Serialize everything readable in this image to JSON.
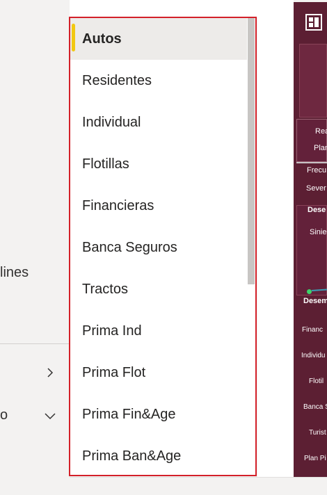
{
  "left_panel": {
    "partial_text": "lines",
    "rows": [
      {
        "label": "",
        "icon": "chevron-right-icon"
      },
      {
        "label": "o",
        "icon": "chevron-down-icon"
      }
    ]
  },
  "dropdown": {
    "selected_index": 0,
    "accent_color": "#f2c811",
    "border_color": "#d32029",
    "options": [
      "Autos",
      "Residentes",
      "Individual",
      "Flotillas",
      "Financieras",
      "Banca Seguros",
      "Tractos",
      "Prima Ind",
      "Prima Flot",
      "Prima Fin&Age",
      "Prima Ban&Age"
    ]
  },
  "report": {
    "background": "#5c1f33",
    "logo_icon": "report-logo-icon",
    "labels": [
      "Rea",
      "Plan",
      "Frecu",
      "Sever",
      "Dese",
      "Sinie",
      "Desem",
      "Financ",
      "Individu",
      "Flotil",
      "Banca S",
      "Turist",
      "Plan Pi"
    ]
  }
}
